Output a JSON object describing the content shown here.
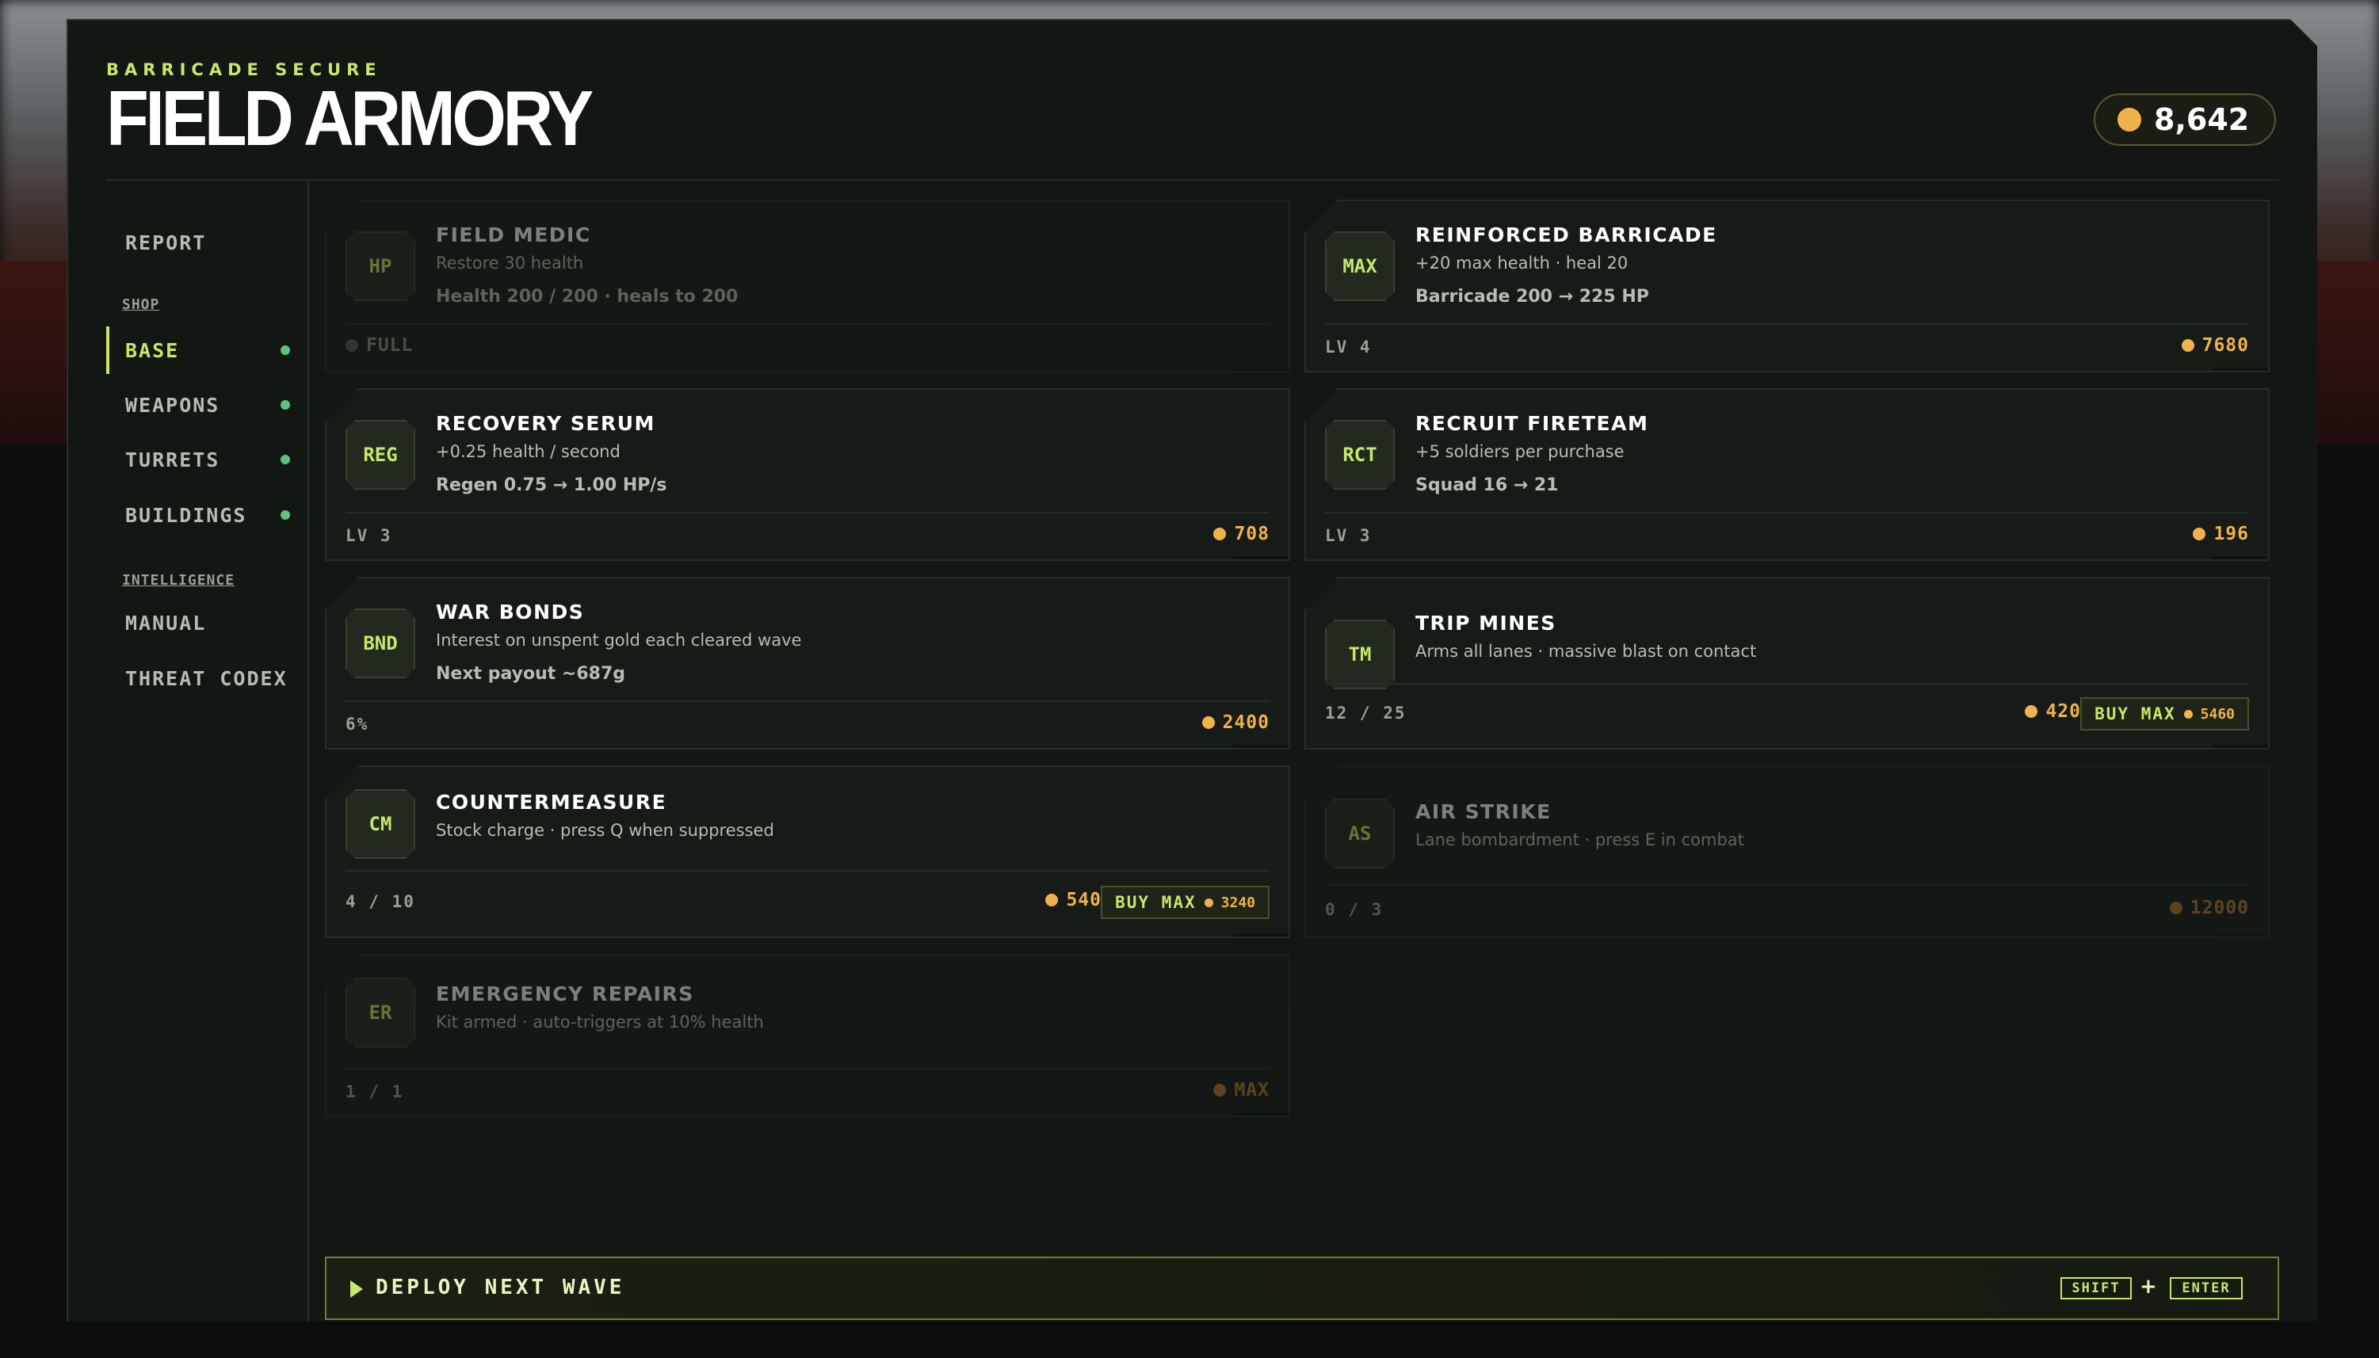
{
  "header": {
    "eyebrow": "BARRICADE SECURE",
    "title": "FIELD ARMORY",
    "gold": "8,642"
  },
  "sidebar": {
    "report": "REPORT",
    "shop_section": "SHOP",
    "items": [
      {
        "label": "BASE",
        "active": true
      },
      {
        "label": "WEAPONS"
      },
      {
        "label": "TURRETS"
      },
      {
        "label": "BUILDINGS"
      }
    ],
    "intel_section": "INTELLIGENCE",
    "manual": "MANUAL",
    "codex": "THREAT CODEX"
  },
  "cards": [
    {
      "badge": "HP",
      "name": "FIELD MEDIC",
      "desc": "Restore 30 health",
      "stat": "Health 200 / 200 · heals to 200",
      "level": "FULL",
      "state": "disabled"
    },
    {
      "badge": "MAX",
      "name": "REINFORCED BARRICADE",
      "desc": "+20 max health · heal 20",
      "stat": "Barricade 200 → 225 HP",
      "level": "LV 4",
      "price": "7680"
    },
    {
      "badge": "REG",
      "name": "RECOVERY SERUM",
      "desc": "+0.25 health / second",
      "stat": "Regen 0.75 → 1.00 HP/s",
      "level": "LV 3",
      "price": "708"
    },
    {
      "badge": "RCT",
      "name": "RECRUIT FIRETEAM",
      "desc": "+5 soldiers per purchase",
      "stat": "Squad 16 → 21",
      "level": "LV 3",
      "price": "196"
    },
    {
      "badge": "BND",
      "name": "WAR BONDS",
      "desc": "Interest on unspent gold each cleared wave",
      "stat": "Next payout ~687g",
      "level": "6%",
      "price": "2400"
    },
    {
      "badge": "TM",
      "name": "TRIP MINES",
      "desc": "Arms all lanes · massive blast on contact",
      "level": "12 / 25",
      "price": "420",
      "buy_max_label": "BUY MAX",
      "buy_max_price": "5460"
    },
    {
      "badge": "CM",
      "name": "COUNTERMEASURE",
      "desc": "Stock charge · press Q when suppressed",
      "level": "4 / 10",
      "price": "540",
      "buy_max_label": "BUY MAX",
      "buy_max_price": "3240"
    },
    {
      "badge": "AS",
      "name": "AIR STRIKE",
      "desc": "Lane bombardment · press E in combat",
      "level": "0 / 3",
      "price": "12000",
      "state": "disabled"
    },
    {
      "badge": "ER",
      "name": "EMERGENCY REPAIRS",
      "desc": "Kit armed · auto-triggers at 10% health",
      "level": "1 / 1",
      "price": "MAX",
      "state": "disabled"
    }
  ],
  "deploy": {
    "label": "DEPLOY NEXT WAVE",
    "key1": "SHIFT",
    "plus": "+",
    "key2": "ENTER"
  },
  "colors": {
    "accent": "#c6e86a",
    "gold": "#f0b24a",
    "ready_dot": "#5dc27a",
    "panel": "#131714"
  }
}
